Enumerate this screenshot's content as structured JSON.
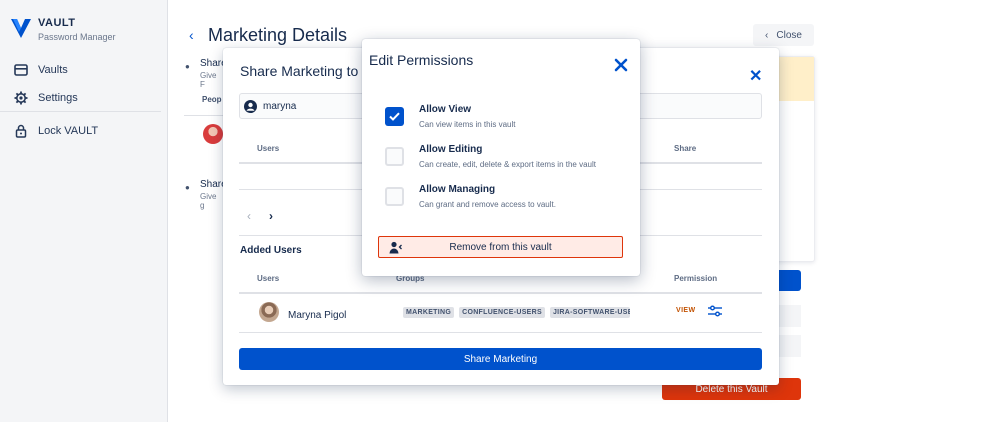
{
  "sidebar": {
    "brand": {
      "title": "VAULT",
      "subtitle": "Password Manager"
    },
    "items": [
      {
        "label": "Vaults",
        "icon": "vault-icon"
      },
      {
        "label": "Settings",
        "icon": "gear-icon"
      },
      {
        "label": "Lock VAULT",
        "icon": "lock-icon"
      }
    ]
  },
  "page": {
    "title": "Marketing Details",
    "close_label": "Close",
    "share_rows": [
      {
        "title": "Share",
        "sub": "Give F"
      },
      {
        "title": "Share",
        "sub": "Give g"
      }
    ],
    "people_header": "Peop",
    "delete_label": "Delete this Vault"
  },
  "share_dialog": {
    "title": "Share Marketing to V",
    "search_value": "maryna",
    "columns": {
      "users": "Users",
      "share": "Share",
      "groups": "Groups",
      "permission": "Permission"
    },
    "added_users_title": "Added Users",
    "added_users": [
      {
        "name": "Maryna Pigol",
        "groups": [
          "MARKETING",
          "CONFLUENCE-USERS",
          "JIRA-SOFTWARE-USERS"
        ],
        "permission": "VIEW"
      }
    ],
    "share_button": "Share Marketing"
  },
  "edit_permissions": {
    "title": "Edit Permissions",
    "options": [
      {
        "title": "Allow View",
        "sub": "Can view items in this vault",
        "checked": true
      },
      {
        "title": "Allow Editing",
        "sub": "Can create, edit, delete & export items in the vault",
        "checked": false
      },
      {
        "title": "Allow Managing",
        "sub": "Can grant and remove access to vault.",
        "checked": false
      }
    ],
    "remove_button": "Remove from this vault"
  },
  "colors": {
    "primary": "#0052cc",
    "danger": "#de350b",
    "danger_light": "#ffebe6",
    "warning_bg": "#ffefc9",
    "view_badge": "#c25100"
  }
}
